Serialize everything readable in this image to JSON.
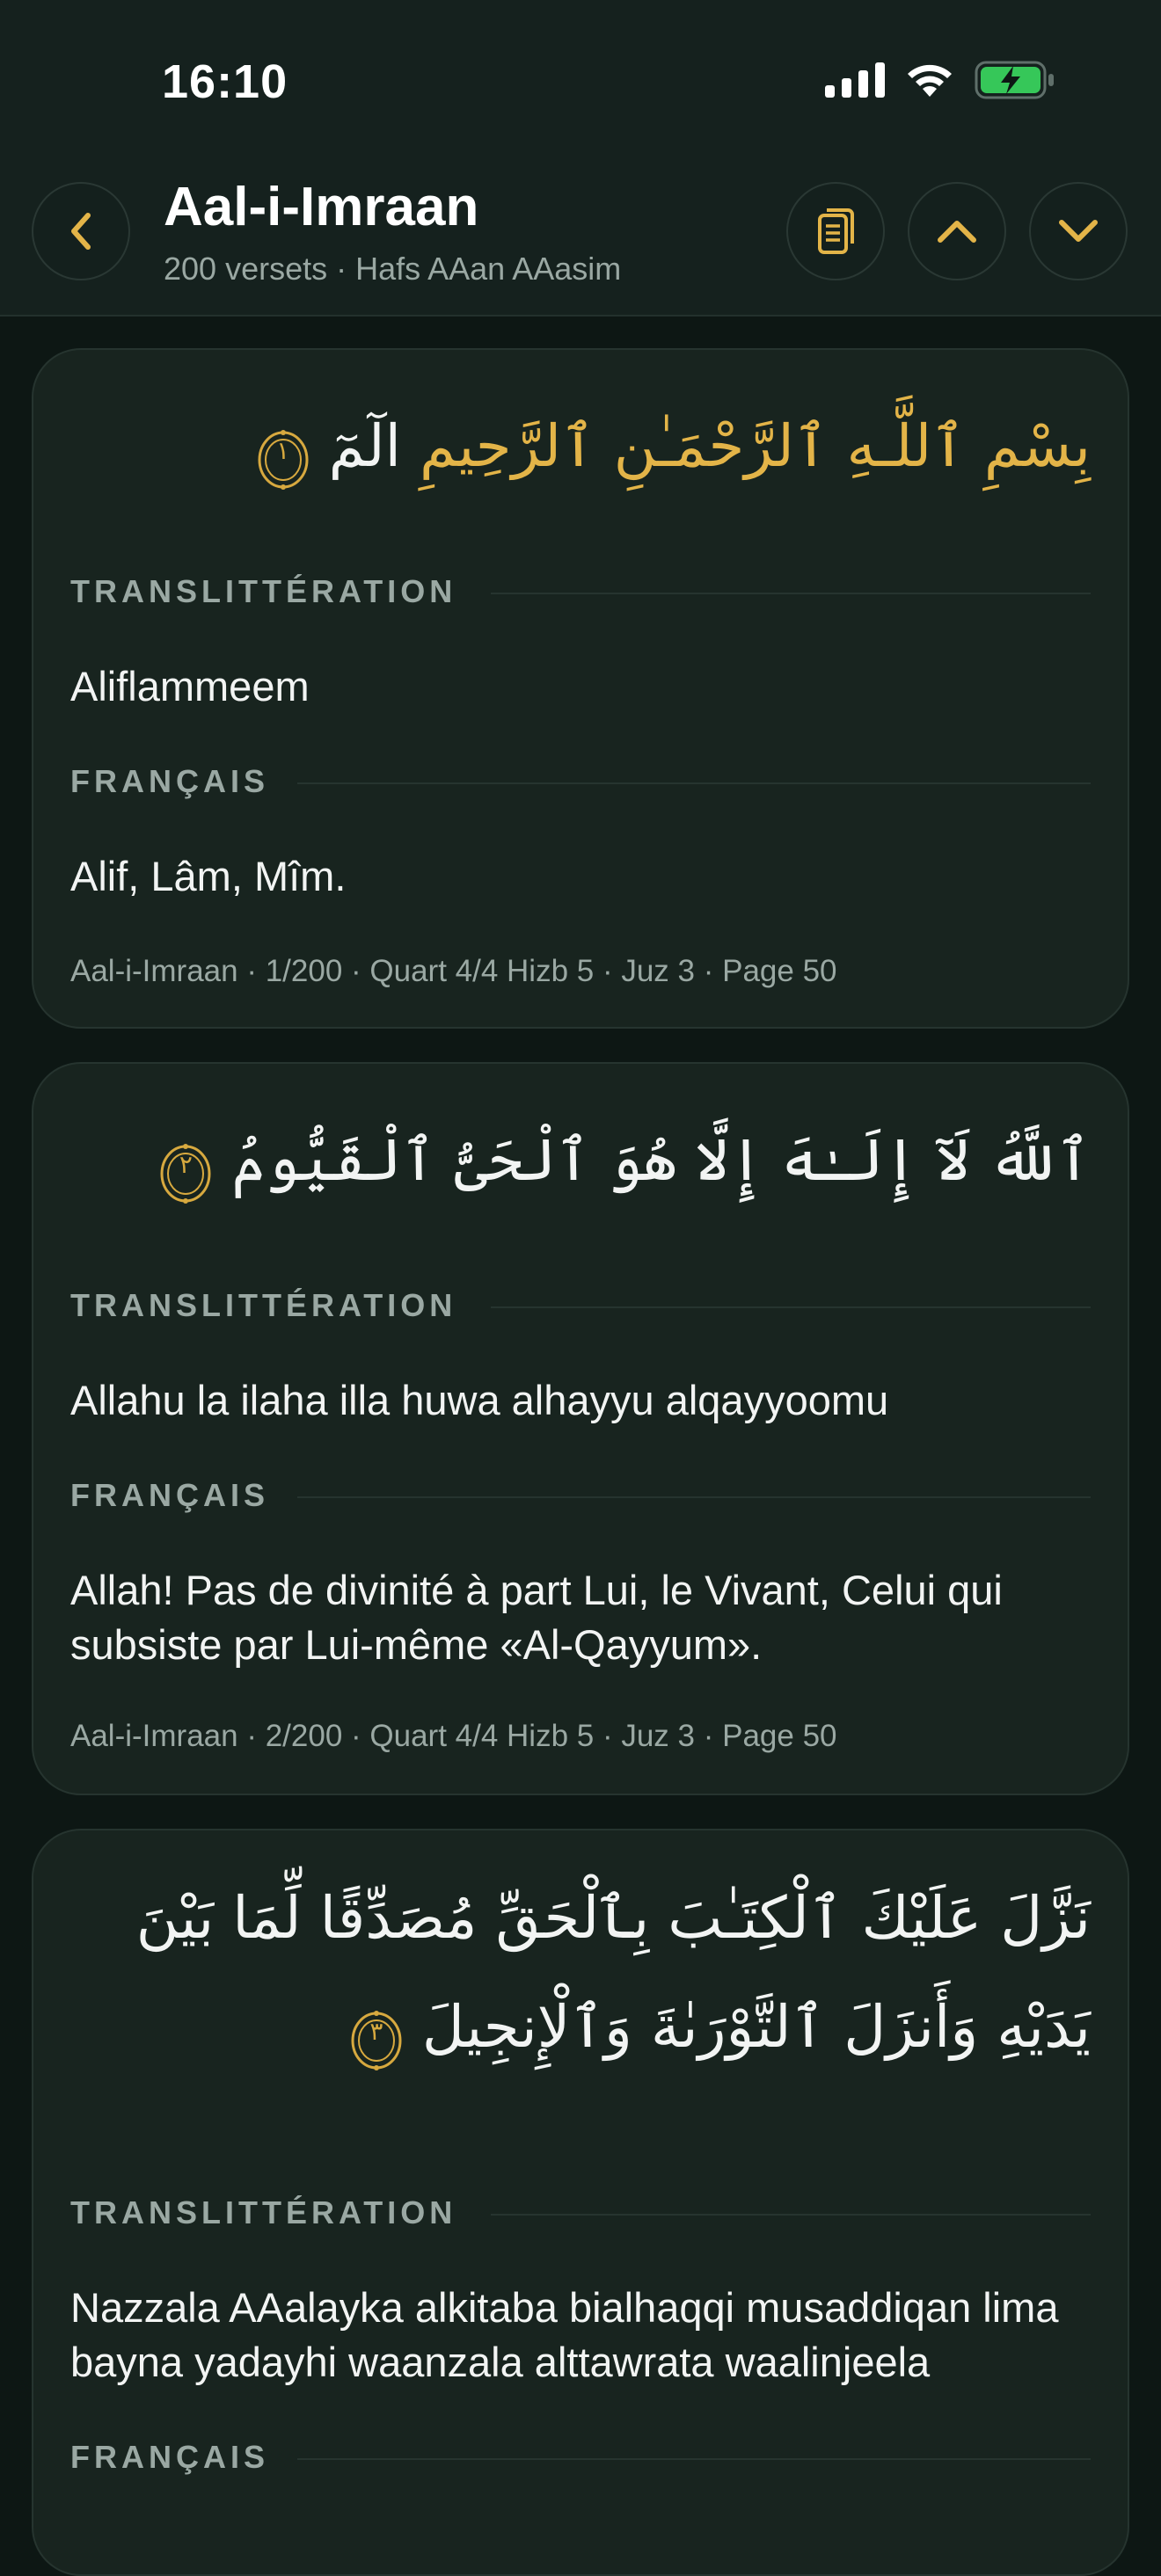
{
  "status_bar": {
    "time": "16:10",
    "icons": [
      "signal-icon",
      "wifi-icon",
      "battery-charging-icon"
    ],
    "battery_color": "#36c759"
  },
  "header": {
    "title": "Aal-i-Imraan",
    "subtitle": "200 versets · Hafs AAan AAasim",
    "accent": "#e3b448",
    "buttons": [
      "back-button",
      "reading-mode-button",
      "previous-verse-button",
      "next-verse-button"
    ]
  },
  "labels": {
    "transliteration": "TRANSLITTÉRATION",
    "french": "FRANÇAIS"
  },
  "verses": [
    {
      "basmala": "بِسْمِ ٱللَّـهِ ٱلرَّحْمَـٰنِ ٱلرَّحِيمِ",
      "arabic": "الٓمٓ",
      "number": "١",
      "transliteration": "Aliflammeem",
      "french": "Alif, Lâm, Mîm.",
      "meta": "Aal-i-Imraan · 1/200 · Quart 4/4 Hizb 5 · Juz 3 · Page 50"
    },
    {
      "arabic": "ٱللَّهُ لَآ إِلَـٰهَ إِلَّا هُوَ ٱلْحَىُّ ٱلْقَيُّومُ",
      "number": "٢",
      "transliteration": "Allahu la ilaha illa huwa alhayyu alqayyoomu",
      "french": "Allah! Pas de divinité à part Lui, le Vivant, Celui qui subsiste par Lui-même «Al-Qayyum».",
      "meta": "Aal-i-Imraan · 2/200 · Quart 4/4 Hizb 5 · Juz 3 · Page 50"
    },
    {
      "arabic_line1": "نَزَّلَ عَلَيْكَ ٱلْكِتَـٰبَ بِٱلْحَقِّ مُصَدِّقًا لِّمَا بَيْنَ",
      "arabic_line2": "يَدَيْهِ وَأَنزَلَ ٱلتَّوْرَىٰةَ وَٱلْإِنجِيلَ",
      "number": "٣",
      "transliteration": "Nazzala AAalayka alkitaba bialhaqqi musaddiqan lima bayna yadayhi waanzala alttawrata waalinjeela"
    }
  ]
}
